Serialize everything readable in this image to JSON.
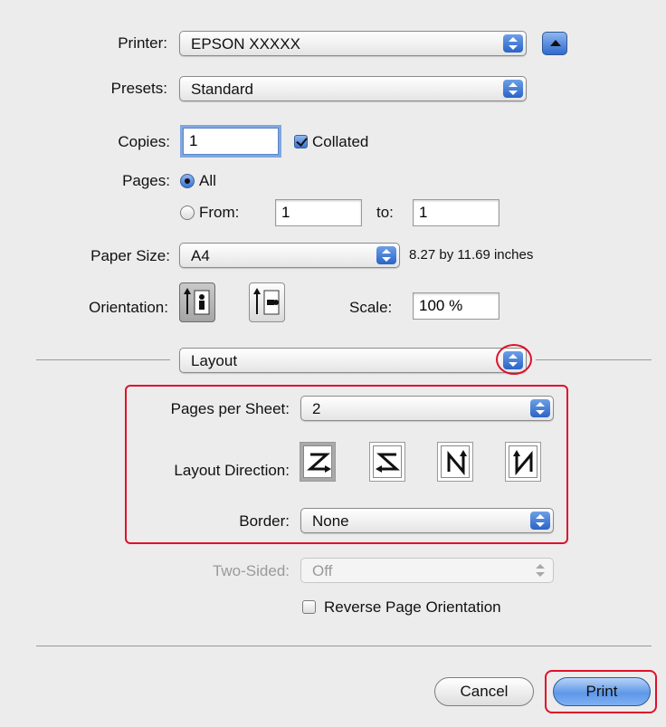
{
  "printer": {
    "label": "Printer:",
    "value": "EPSON XXXXX"
  },
  "presets": {
    "label": "Presets:",
    "value": "Standard"
  },
  "copies": {
    "label": "Copies:",
    "value": "1",
    "collated_label": "Collated",
    "collated": true
  },
  "pages": {
    "label": "Pages:",
    "all_label": "All",
    "from_label": "From:",
    "from_value": "1",
    "to_label": "to:",
    "to_value": "1",
    "selected": "all"
  },
  "paper_size": {
    "label": "Paper Size:",
    "value": "A4",
    "dimensions": "8.27 by 11.69 inches"
  },
  "orientation": {
    "label": "Orientation:",
    "selected": "portrait"
  },
  "scale": {
    "label": "Scale:",
    "value": "100 %"
  },
  "panel": {
    "value": "Layout"
  },
  "layout": {
    "pages_per_sheet_label": "Pages per Sheet:",
    "pages_per_sheet": "2",
    "direction_label": "Layout Direction:",
    "direction_selected": 0,
    "border_label": "Border:",
    "border": "None"
  },
  "two_sided": {
    "label": "Two-Sided:",
    "value": "Off",
    "enabled": false
  },
  "reverse": {
    "label": "Reverse Page Orientation",
    "checked": false
  },
  "buttons": {
    "cancel": "Cancel",
    "print": "Print"
  },
  "colors": {
    "highlight": "#e0102a",
    "accent": "#3a74d0"
  }
}
